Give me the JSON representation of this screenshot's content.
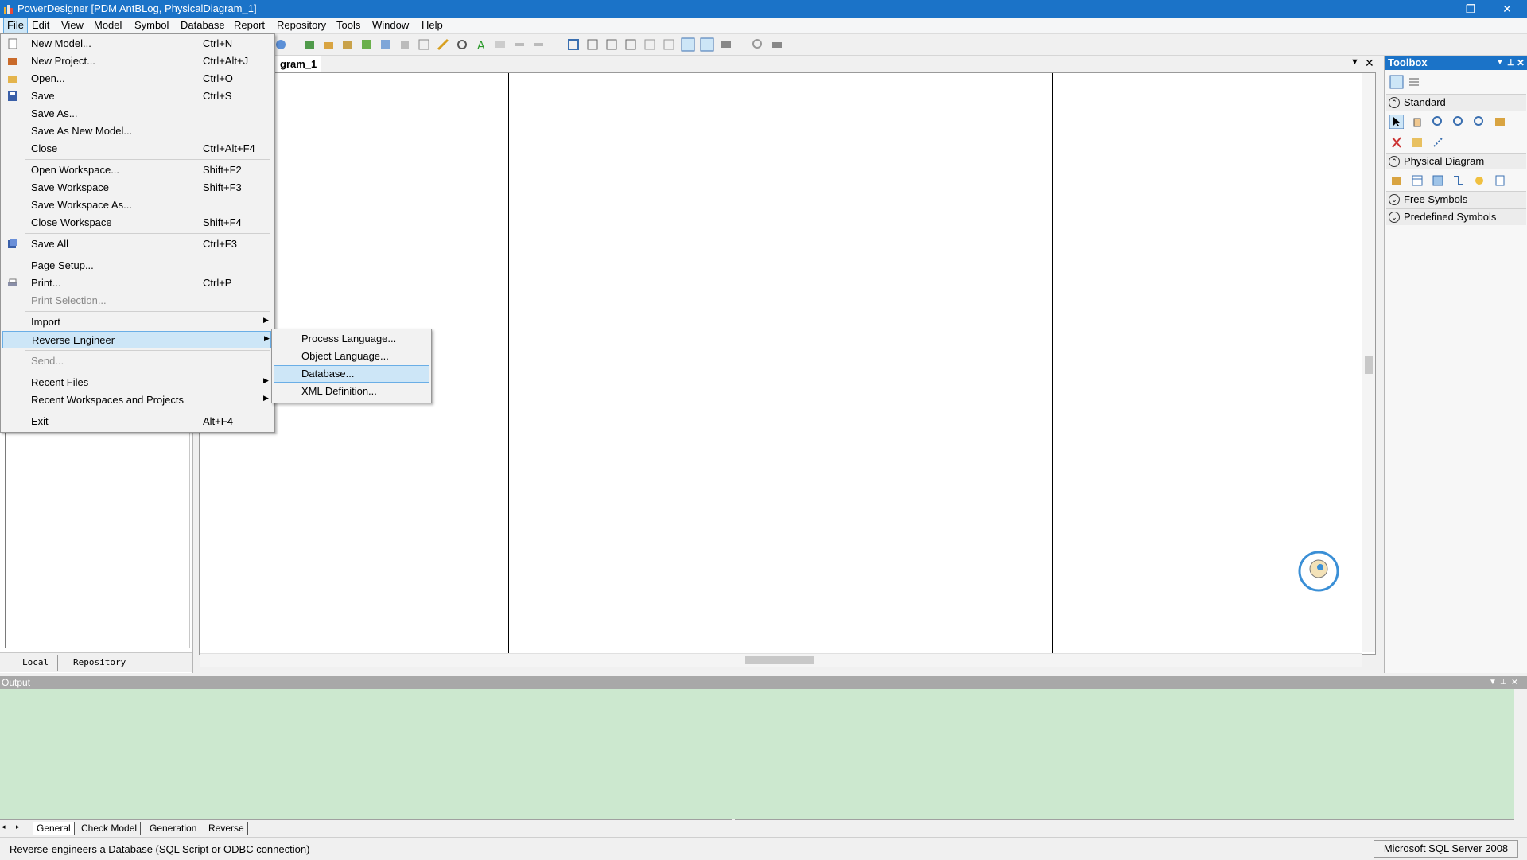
{
  "window": {
    "title": "PowerDesigner [PDM AntBLog, PhysicalDiagram_1]",
    "controls": [
      "–",
      "❐",
      "✕"
    ]
  },
  "menubar": {
    "items": [
      "File",
      "Edit",
      "View",
      "Model",
      "Symbol",
      "Database",
      "Report",
      "Repository",
      "Tools",
      "Window",
      "Help"
    ],
    "active": "File"
  },
  "file_menu": {
    "items": [
      {
        "label": "New Model...",
        "shortcut": "Ctrl+N"
      },
      {
        "label": "New Project...",
        "shortcut": "Ctrl+Alt+J"
      },
      {
        "label": "Open...",
        "shortcut": "Ctrl+O"
      },
      {
        "label": "Save",
        "shortcut": "Ctrl+S"
      },
      {
        "label": "Save As...",
        "shortcut": ""
      },
      {
        "label": "Save As New Model...",
        "shortcut": ""
      },
      {
        "label": "Close",
        "shortcut": "Ctrl+Alt+F4"
      },
      {
        "label": "Open Workspace...",
        "shortcut": "Shift+F2"
      },
      {
        "label": "Save Workspace",
        "shortcut": "Shift+F3"
      },
      {
        "label": "Save Workspace As...",
        "shortcut": ""
      },
      {
        "label": "Close Workspace",
        "shortcut": "Shift+F4"
      },
      {
        "label": "Save All",
        "shortcut": "Ctrl+F3"
      },
      {
        "label": "Page Setup...",
        "shortcut": ""
      },
      {
        "label": "Print...",
        "shortcut": "Ctrl+P"
      },
      {
        "label": "Print Selection...",
        "shortcut": ""
      },
      {
        "label": "Import",
        "shortcut": ""
      },
      {
        "label": "Reverse Engineer",
        "shortcut": ""
      },
      {
        "label": "Send...",
        "shortcut": ""
      },
      {
        "label": "Recent Files",
        "shortcut": ""
      },
      {
        "label": "Recent Workspaces and Projects",
        "shortcut": ""
      },
      {
        "label": "Exit",
        "shortcut": "Alt+F4"
      }
    ]
  },
  "reverse_engineer_submenu": {
    "items": [
      "Process Language...",
      "Object Language...",
      "Database...",
      "XML Definition..."
    ],
    "selected": "Database..."
  },
  "document_tab": {
    "label": "gram_1"
  },
  "left_panel": {
    "tabs": [
      "Local",
      "Repository"
    ]
  },
  "toolbox": {
    "title": "Toolbox",
    "sections": [
      {
        "label": "Standard",
        "expanded": true
      },
      {
        "label": "Physical Diagram",
        "expanded": true
      },
      {
        "label": "Free Symbols",
        "expanded": false
      },
      {
        "label": "Predefined Symbols",
        "expanded": false
      }
    ]
  },
  "output": {
    "title": "Output",
    "tabs": [
      "General",
      "Check Model",
      "Generation",
      "Reverse"
    ],
    "background": "#cce8cf"
  },
  "statusbar": {
    "message": "Reverse-engineers a Database  (SQL Script or ODBC connection)",
    "dbms": "Microsoft SQL Server 2008"
  },
  "colors": {
    "accent": "#1b73c8",
    "highlight": "#cde6f7"
  }
}
